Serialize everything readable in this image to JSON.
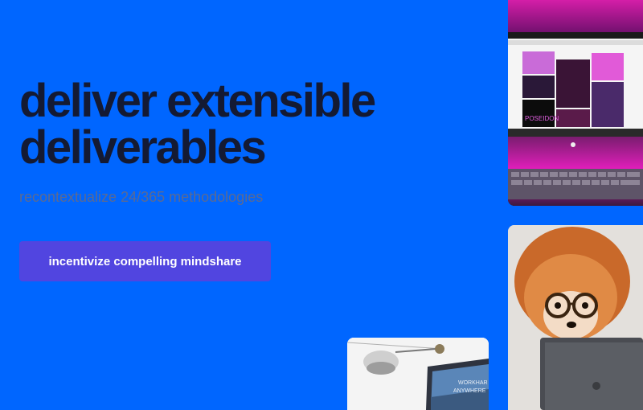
{
  "hero": {
    "headline_line1": "deliver extensible",
    "headline_line2": "deliverables",
    "subheadline": "recontextualize 24/365 methodologies",
    "cta_label": "incentivize compelling mindshare"
  },
  "images": {
    "monitor": {
      "screen_text": "POSEIDON"
    },
    "desk": {
      "screen_text_line1": "WORKHAR",
      "screen_text_line2": "ANYWHERE"
    }
  },
  "colors": {
    "background": "#0066ff",
    "headline": "#141a33",
    "subheadline": "#5b6a92",
    "cta": "#5145e0"
  }
}
